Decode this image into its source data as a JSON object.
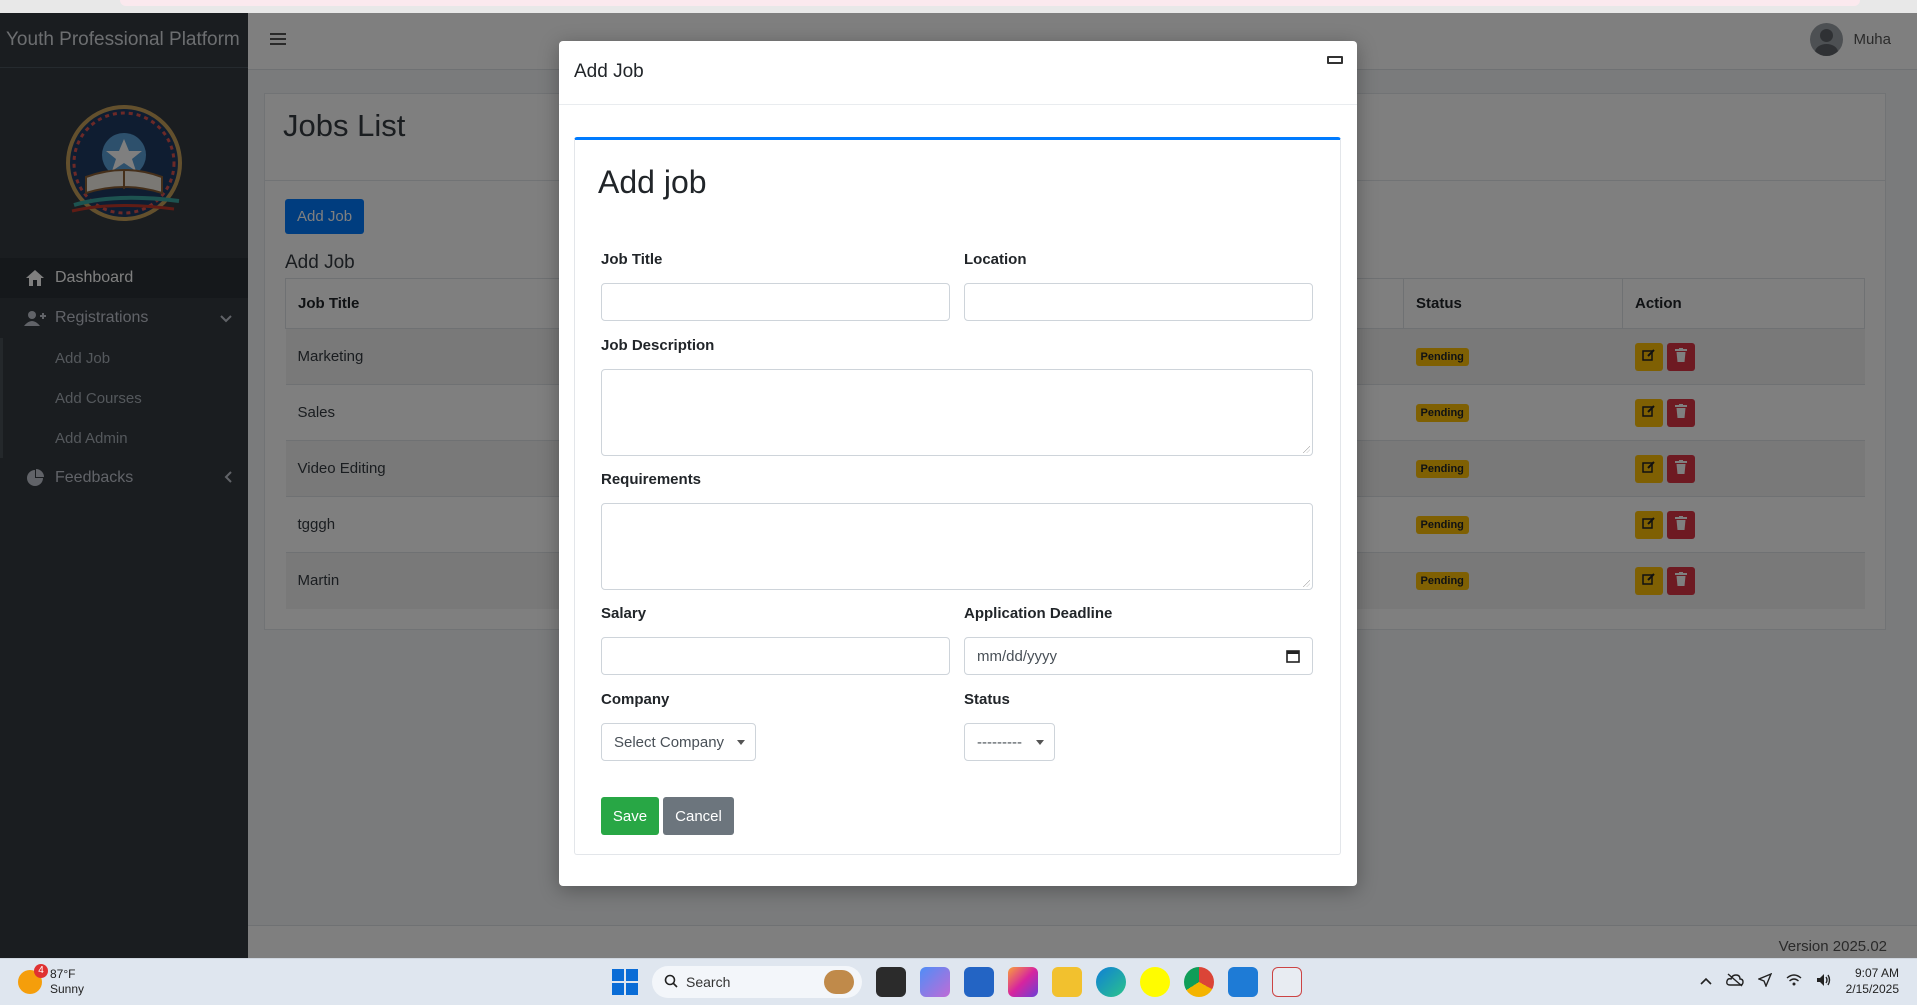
{
  "app": {
    "brand": "Youth Professional Platform",
    "user_name": "Muha"
  },
  "sidebar": {
    "items": [
      {
        "label": "Dashboard"
      },
      {
        "label": "Registrations"
      },
      {
        "label": "Add Job"
      },
      {
        "label": "Add Courses"
      },
      {
        "label": "Add Admin"
      },
      {
        "label": "Feedbacks"
      }
    ]
  },
  "page": {
    "title": "Jobs List",
    "add_button": "Add Job",
    "section_title": "Add Job",
    "columns": [
      "Job Title",
      "Status",
      "Action"
    ],
    "rows": [
      {
        "title": "Marketing",
        "status": "Pending"
      },
      {
        "title": "Sales",
        "status": "Pending"
      },
      {
        "title": "Video Editing",
        "status": "Pending"
      },
      {
        "title": "tgggh",
        "status": "Pending"
      },
      {
        "title": "Martin",
        "status": "Pending"
      }
    ],
    "version": "Version 2025.02"
  },
  "modal": {
    "title": "Add Job",
    "heading": "Add job",
    "fields": {
      "job_title": "Job Title",
      "location": "Location",
      "job_description": "Job Description",
      "requirements": "Requirements",
      "salary": "Salary",
      "deadline": "Application Deadline",
      "deadline_placeholder": "mm/dd/yyyy",
      "company": "Company",
      "company_value": "Select Company",
      "status": "Status",
      "status_value": "---------"
    },
    "save": "Save",
    "cancel": "Cancel"
  },
  "taskbar": {
    "temp": "87°F",
    "weather": "Sunny",
    "weather_badge": "4",
    "search": "Search",
    "time": "9:07 AM",
    "date": "2/15/2025"
  },
  "colors": {
    "sidebar": "#343a40",
    "primary": "#007bff",
    "success": "#28a745",
    "secondary": "#6c757d",
    "warning": "#ffc107",
    "danger": "#dc3545"
  }
}
